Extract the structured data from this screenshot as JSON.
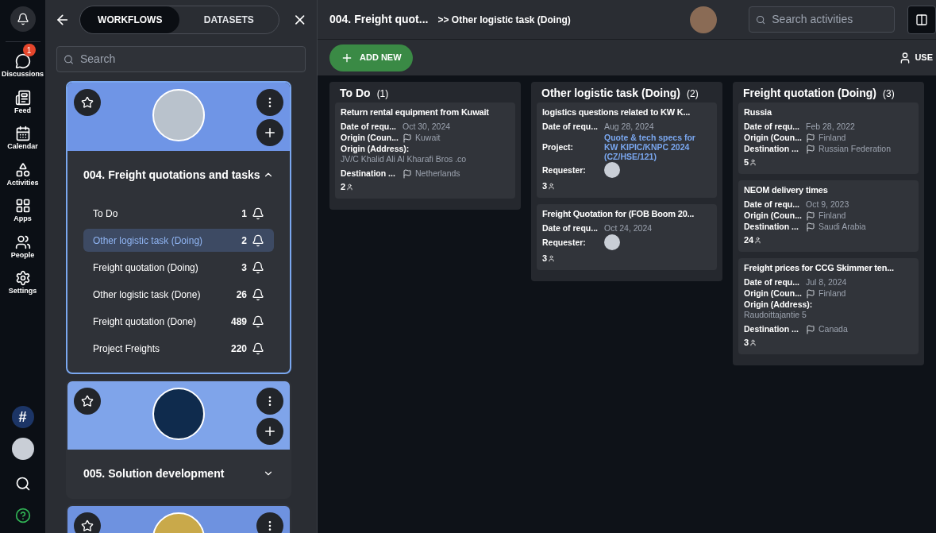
{
  "rail": {
    "items": [
      {
        "label": "Discussions",
        "badge": "1"
      },
      {
        "label": "Feed"
      },
      {
        "label": "Calendar"
      },
      {
        "label": "Activities"
      },
      {
        "label": "Apps"
      },
      {
        "label": "People"
      },
      {
        "label": "Settings"
      }
    ],
    "hash": "#"
  },
  "panel": {
    "tabs": [
      {
        "label": "WORKFLOWS",
        "selected": true
      },
      {
        "label": "DATASETS",
        "selected": false
      }
    ],
    "search": {
      "placeholder": "Search"
    },
    "workflows": [
      {
        "title": "004. Freight quotations and tasks",
        "expanded": true,
        "selected": true,
        "items": [
          {
            "label": "To Do",
            "count": "1",
            "selected": false
          },
          {
            "label": "Other logistic task (Doing)",
            "count": "2",
            "selected": true
          },
          {
            "label": "Freight quotation (Doing)",
            "count": "3",
            "selected": false
          },
          {
            "label": "Other logistic task (Done)",
            "count": "26",
            "selected": false
          },
          {
            "label": "Freight quotation (Done)",
            "count": "489",
            "selected": false
          },
          {
            "label": "Project Freights",
            "count": "220",
            "selected": false
          }
        ]
      },
      {
        "title": "005. Solution development",
        "expanded": false,
        "selected": false
      },
      {
        "expanded": false,
        "selected": false
      }
    ]
  },
  "header": {
    "title": "004. Freight quot...",
    "breadcrumb": ">> Other logistic task (Doing)",
    "search": {
      "placeholder": "Search activities"
    }
  },
  "toolbar": {
    "add": "ADD NEW",
    "user": "USE"
  },
  "columns": [
    {
      "title": "To Do",
      "count": "(1)",
      "cards": [
        {
          "title": "Return rental equipment from Kuwait",
          "people": "2",
          "fields": [
            {
              "kind": "text",
              "label": "Date of requ...",
              "value": "Oct 30, 2024"
            },
            {
              "kind": "flag",
              "label": "Origin (Coun...",
              "value": "Kuwait"
            },
            {
              "kind": "address",
              "label": "Origin (Address):",
              "value": "JV/C Khalid Ali Al Kharafi Bros .co"
            },
            {
              "kind": "flag",
              "label": "Destination ...",
              "value": "Netherlands"
            }
          ]
        }
      ]
    },
    {
      "title": "Other logistic task (Doing)",
      "count": "(2)",
      "cards": [
        {
          "title": "logistics questions related to KW K...",
          "people": "3",
          "fields": [
            {
              "kind": "text",
              "label": "Date of requ...",
              "value": "Aug 28, 2024"
            },
            {
              "kind": "link",
              "label": "Project:",
              "value": "Quote & tech specs for KW KIPIC/KNPC 2024 (CZ/HSE/121)"
            },
            {
              "kind": "avatar",
              "label": "Requester:"
            }
          ]
        },
        {
          "title": "Freight Quotation for (FOB Boom 20...",
          "people": "3",
          "fields": [
            {
              "kind": "text",
              "label": "Date of requ...",
              "value": "Oct 24, 2024"
            },
            {
              "kind": "avatar",
              "label": "Requester:"
            }
          ]
        }
      ]
    },
    {
      "title": "Freight quotation (Doing)",
      "count": "(3)",
      "cards": [
        {
          "title": "Russia",
          "people": "5",
          "fields": [
            {
              "kind": "text",
              "label": "Date of requ...",
              "value": "Feb 28, 2022"
            },
            {
              "kind": "flag",
              "label": "Origin (Coun...",
              "value": "Finland"
            },
            {
              "kind": "flag",
              "label": "Destination ...",
              "value": "Russian Federation"
            }
          ]
        },
        {
          "title": "NEOM delivery times",
          "people": "24",
          "fields": [
            {
              "kind": "text",
              "label": "Date of requ...",
              "value": "Oct 9, 2023"
            },
            {
              "kind": "flag",
              "label": "Origin (Coun...",
              "value": "Finland"
            },
            {
              "kind": "flag",
              "label": "Destination ...",
              "value": "Saudi Arabia"
            }
          ]
        },
        {
          "title": "Freight prices for CCG Skimmer ten...",
          "people": "3",
          "fields": [
            {
              "kind": "text",
              "label": "Date of requ...",
              "value": "Jul 8, 2024"
            },
            {
              "kind": "flag",
              "label": "Origin (Coun...",
              "value": "Finland"
            },
            {
              "kind": "address",
              "label": "Origin (Address):",
              "value": "Raudoittajantie 5"
            },
            {
              "kind": "flag",
              "label": "Destination ...",
              "value": "Canada"
            }
          ]
        }
      ]
    }
  ]
}
